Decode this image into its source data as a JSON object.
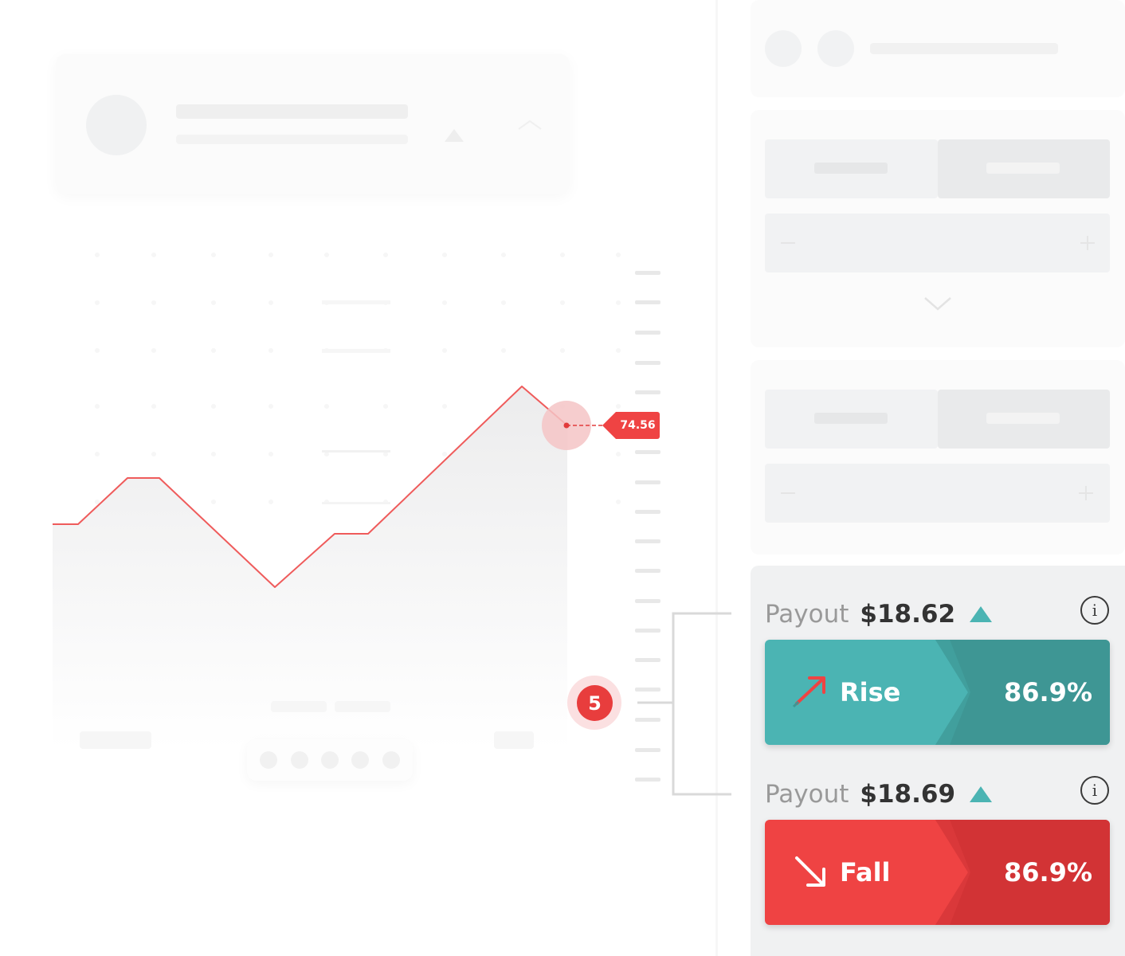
{
  "chart": {
    "current_price": "74.56"
  },
  "step": {
    "number": "5"
  },
  "trade": {
    "rise": {
      "payout_label": "Payout",
      "payout_amount": "$18.62",
      "label": "Rise",
      "percent": "86.9%",
      "color": "#4bb4b3",
      "color_dark": "#3e9694"
    },
    "fall": {
      "payout_label": "Payout",
      "payout_amount": "$18.69",
      "label": "Fall",
      "percent": "86.9%",
      "color": "#ef4343",
      "color_dark": "#d23335"
    },
    "info_icon": "info-icon"
  },
  "colors": {
    "accent_red": "#ef4343",
    "accent_teal": "#4bb4b3"
  }
}
